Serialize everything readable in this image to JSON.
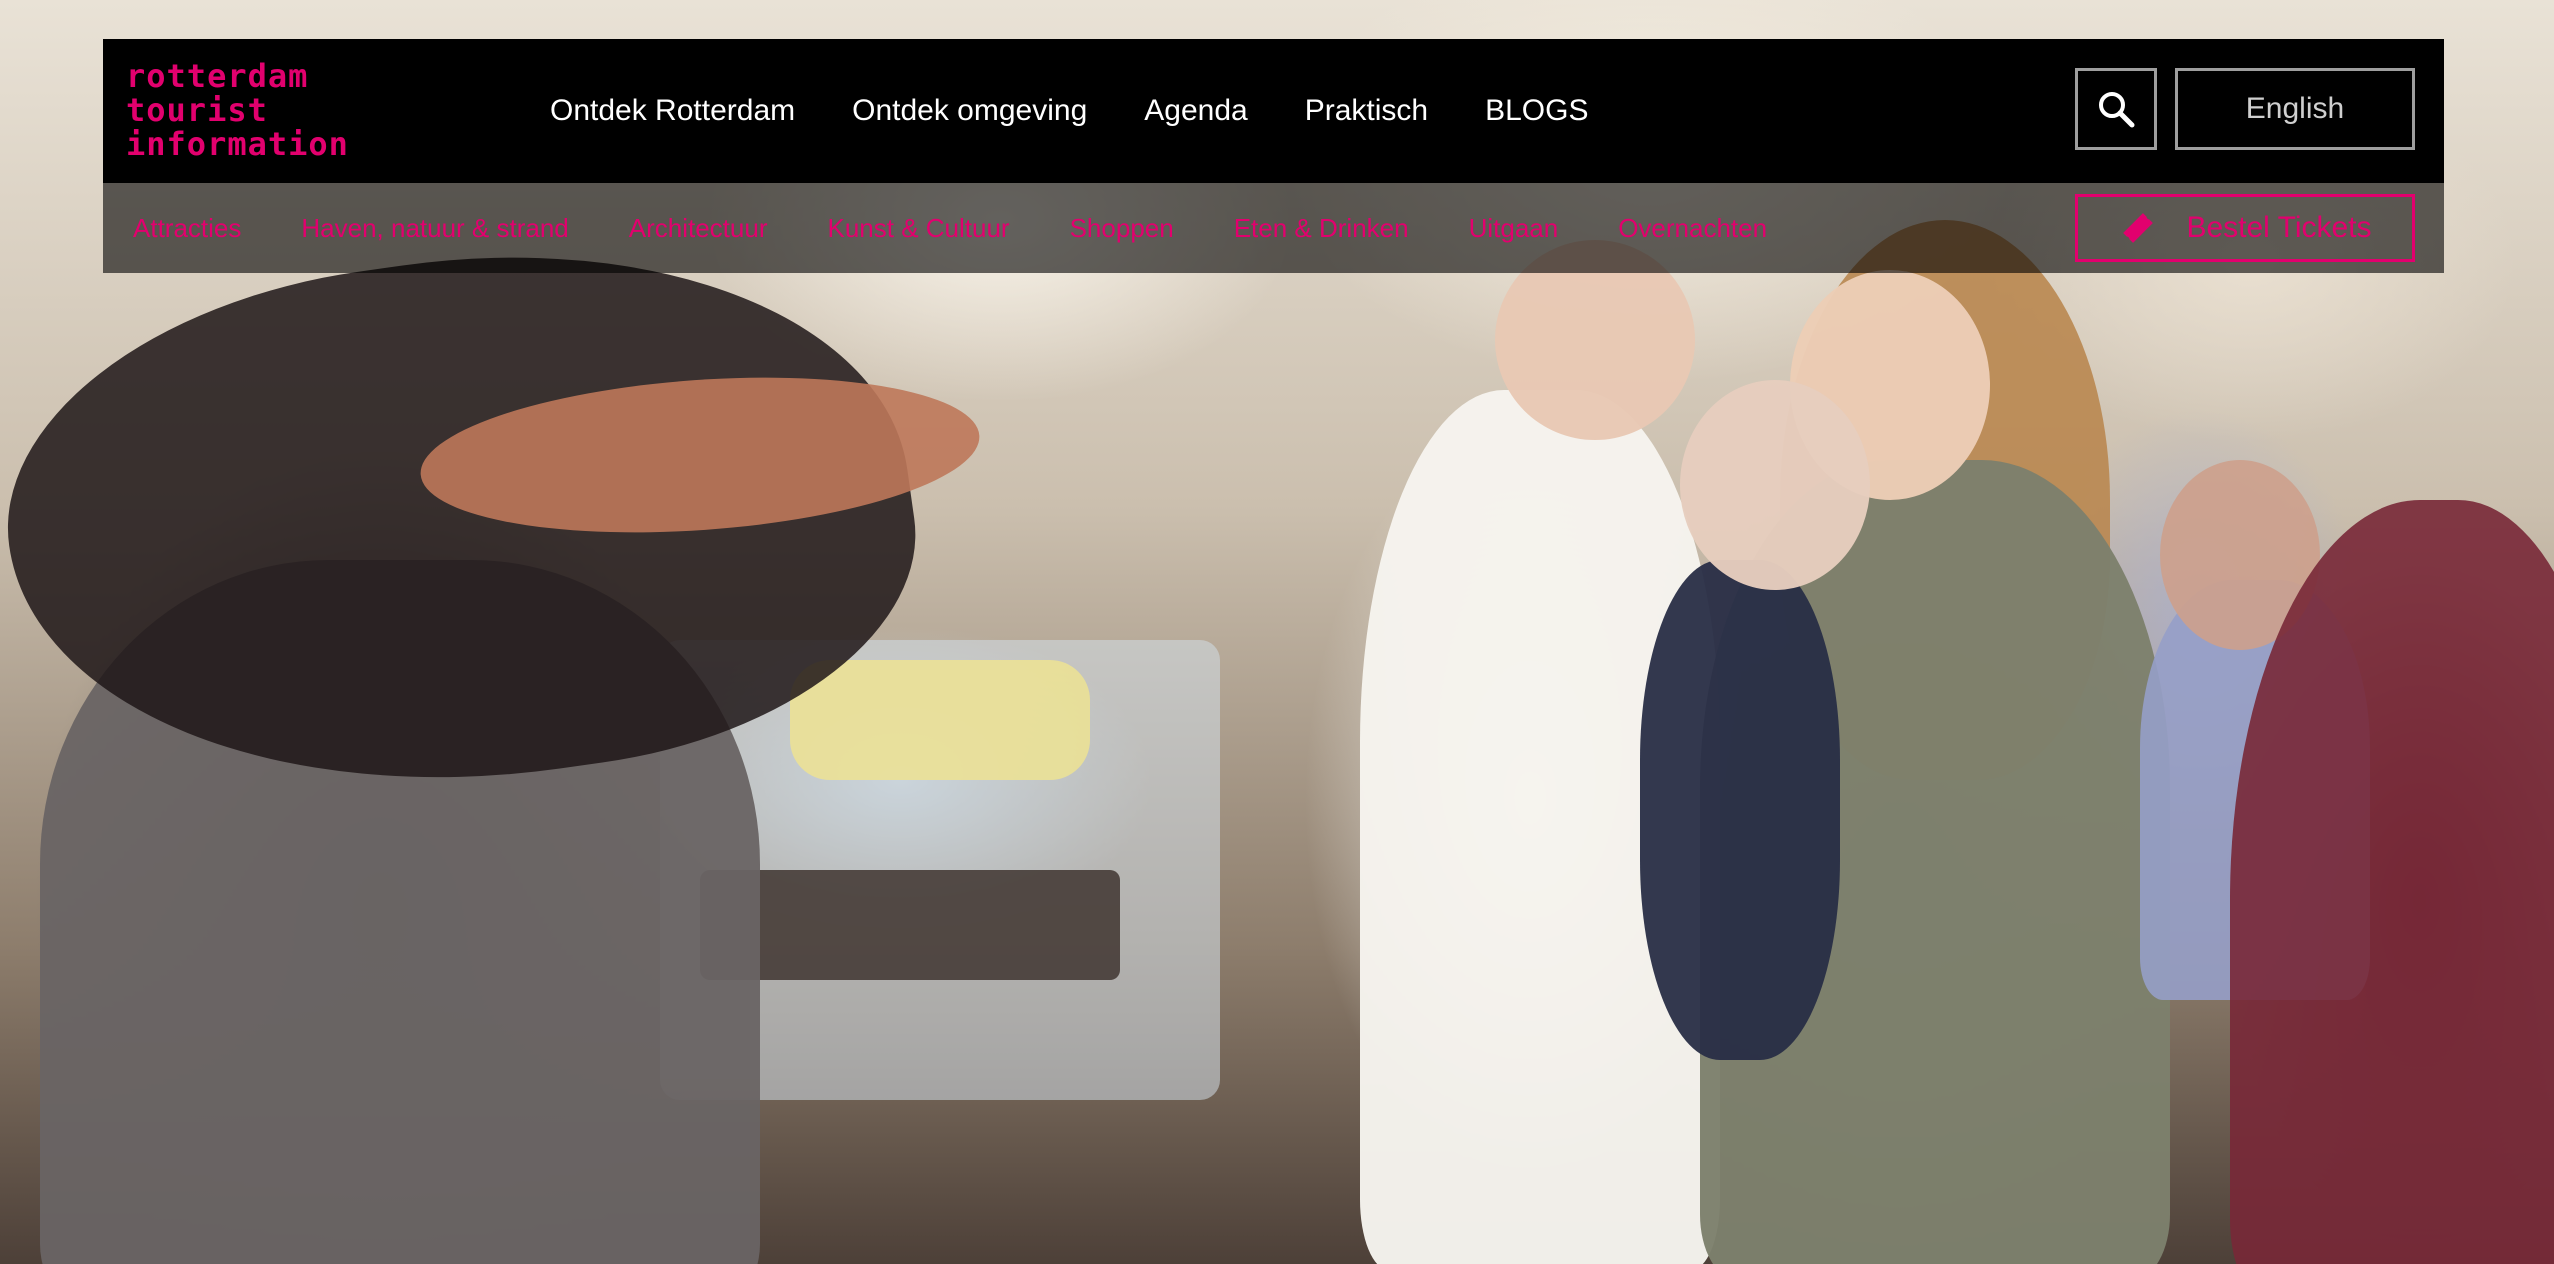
{
  "logo": {
    "line1": "rotterdam",
    "line2": "tourist",
    "line3": "information"
  },
  "main_nav": [
    {
      "label": "Ontdek Rotterdam"
    },
    {
      "label": "Ontdek omgeving"
    },
    {
      "label": "Agenda"
    },
    {
      "label": "Praktisch"
    },
    {
      "label": "BLOGS"
    }
  ],
  "search": {
    "icon": "search-icon"
  },
  "language": {
    "label": "English"
  },
  "sub_nav": [
    {
      "label": "Attracties"
    },
    {
      "label": "Haven, natuur & strand"
    },
    {
      "label": "Architectuur"
    },
    {
      "label": "Kunst & Cultuur"
    },
    {
      "label": "Shoppen"
    },
    {
      "label": "Eten & Drinken"
    },
    {
      "label": "Uitgaan"
    },
    {
      "label": "Overnachten"
    }
  ],
  "tickets": {
    "label": "Bestel Tickets",
    "icon": "ticket-icon"
  },
  "colors": {
    "brand": "#e2006e",
    "header_bg": "#000000",
    "nav_text": "#ffffff",
    "button_border": "#9e9e9e"
  }
}
